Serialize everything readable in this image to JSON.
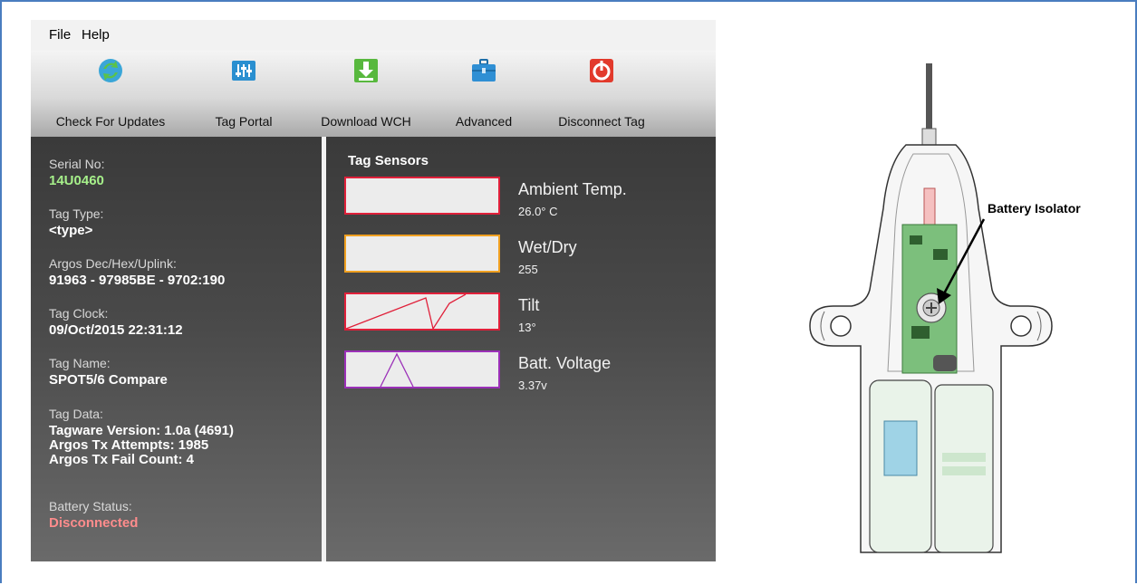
{
  "menu": {
    "file": "File",
    "help": "Help"
  },
  "toolbar": {
    "check_updates": "Check For Updates",
    "tag_portal": "Tag Portal",
    "download_wch": "Download WCH",
    "advanced": "Advanced",
    "disconnect_tag": "Disconnect Tag"
  },
  "info": {
    "serial_label": "Serial No:",
    "serial_value": "14U0460",
    "type_label": "Tag Type:",
    "type_value": "<type>",
    "argos_label": "Argos Dec/Hex/Uplink:",
    "argos_value": "91963 - 97985BE - 9702:190",
    "clock_label": "Tag Clock:",
    "clock_value": "09/Oct/2015 22:31:12",
    "name_label": "Tag Name:",
    "name_value": "SPOT5/6 Compare",
    "data_label": "Tag Data:",
    "data_line1": "Tagware Version: 1.0a (4691)",
    "data_line2": "Argos Tx Attempts: 1985",
    "data_line3": "Argos Tx Fail Count: 4",
    "battery_label": "Battery Status:",
    "battery_value": "Disconnected"
  },
  "sensors": {
    "title": "Tag Sensors",
    "ambient_name": "Ambient Temp.",
    "ambient_value": "26.0° C",
    "wetdry_name": "Wet/Dry",
    "wetdry_value": "255",
    "tilt_name": "Tilt",
    "tilt_value": "13°",
    "batt_name": "Batt. Voltage",
    "batt_value": "3.37v"
  },
  "colors": {
    "ambient": "#e0203a",
    "wetdry": "#f0a020",
    "tilt": "#e0203a",
    "batt": "#9b30b8"
  },
  "diagram": {
    "callout": "Battery Isolator"
  }
}
